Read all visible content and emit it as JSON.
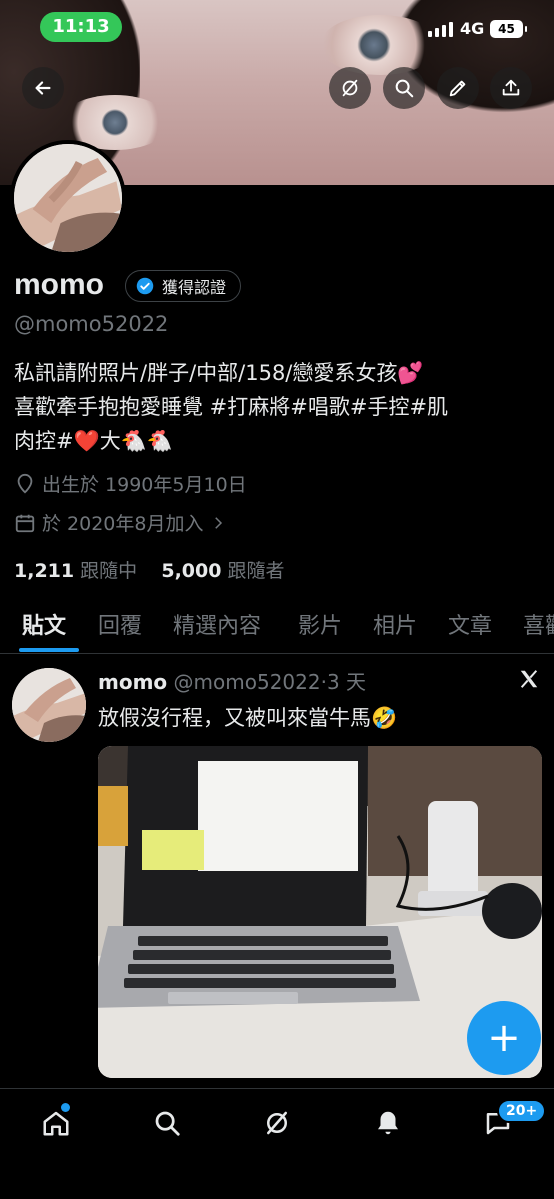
{
  "status_bar": {
    "time": "11:13",
    "network": "4G",
    "battery": "45"
  },
  "profile": {
    "name": "momo",
    "verified_label": "獲得認證",
    "handle": "@momo52022",
    "bio_line1": "私訊請附照片/胖子/中部/158/戀愛系女孩💕",
    "bio_line2": "喜歡牽手抱抱愛睡覺 #打麻將#唱歌#手控#肌",
    "bio_line3": "肉控#❤️大🐔🐔",
    "birth": "出生於 1990年5月10日",
    "joined": "於 2020年8月加入",
    "following_count": "1,211",
    "following_label": "跟隨中",
    "followers_count": "5,000",
    "followers_label": "跟隨者"
  },
  "tabs": [
    "貼文",
    "回覆",
    "精選內容",
    "影片",
    "相片",
    "文章",
    "喜歡"
  ],
  "post": {
    "author": "momo",
    "handle": "@momo52022",
    "separator": "·",
    "time": "3 天",
    "text": "放假沒行程，又被叫來當牛馬🤣"
  },
  "fab_label": "+",
  "nav": {
    "messages_badge": "20+"
  },
  "colors": {
    "accent": "#1d9bf0",
    "time_pill": "#34c759",
    "muted": "#71767b"
  },
  "icons": [
    "back-icon",
    "grok-icon",
    "search-icon",
    "edit-icon",
    "share-icon",
    "location-icon",
    "calendar-icon",
    "x-logo-icon",
    "home-icon",
    "bell-icon",
    "mail-icon"
  ]
}
